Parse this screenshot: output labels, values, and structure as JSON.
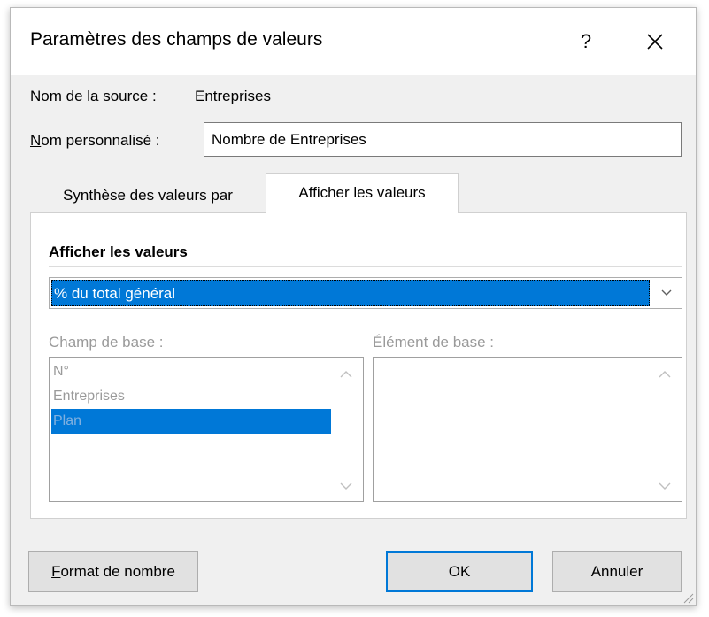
{
  "dialog": {
    "title": "Paramètres des champs de valeurs",
    "help_label": "?",
    "source_name_label": "Nom de la source :",
    "source_name_value": "Entreprises",
    "custom_name_label_first": "N",
    "custom_name_label_rest": "om personnalisé :",
    "custom_name_value": "Nombre de Entreprises"
  },
  "tabs": [
    {
      "label": "Synthèse des valeurs par",
      "active": false
    },
    {
      "label": "Afficher les valeurs",
      "active": true
    }
  ],
  "panel": {
    "section_title_first": "A",
    "section_title_rest": "fficher les valeurs",
    "show_values_as": "% du total général",
    "base_field_label": "Champ de base :",
    "base_item_label": "Élément de base :",
    "base_fields": [
      "N°",
      "Entreprises",
      "Plan"
    ],
    "selected_base_field": "Plan",
    "base_items": []
  },
  "buttons": {
    "number_format_first": "F",
    "number_format_rest": "ormat de nombre",
    "ok": "OK",
    "cancel": "Annuler"
  },
  "colors": {
    "selection": "#0078d7",
    "dialog_bg": "#f0f0f0",
    "default_button_border": "#0078d7",
    "disabled_text": "#9a9a9a"
  },
  "icons": {
    "close": "close-icon",
    "dropdown": "chevron-down-icon",
    "scroll_up": "scroll-up-icon",
    "scroll_down": "scroll-down-icon",
    "resize": "resize-grip-icon"
  }
}
